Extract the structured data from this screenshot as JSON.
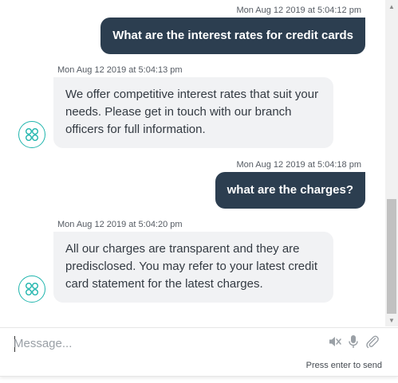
{
  "messages": [
    {
      "sender": "user",
      "timestamp": "Mon Aug 12 2019 at 5:04:12 pm",
      "text": "What are the interest rates for credit cards"
    },
    {
      "sender": "bot",
      "timestamp": "Mon Aug 12 2019 at 5:04:13 pm",
      "text": "We offer competitive interest rates that suit your needs. Please get in touch with our branch officers for full information."
    },
    {
      "sender": "user",
      "timestamp": "Mon Aug 12 2019 at 5:04:18 pm",
      "text": "what are the charges?"
    },
    {
      "sender": "bot",
      "timestamp": "Mon Aug 12 2019 at 5:04:20 pm",
      "text": "All our charges are transparent and they are predisclosed. You may refer to your latest credit card statement for the latest charges."
    }
  ],
  "composer": {
    "placeholder": "Message...",
    "value": "",
    "icons": [
      "speaker-mute-icon",
      "microphone-icon",
      "paperclip-icon"
    ],
    "hint": "Press enter to send"
  },
  "colors": {
    "user_bubble": "#2c3e50",
    "bot_bubble": "#f1f2f4",
    "avatar_accent": "#1fb5ad"
  }
}
